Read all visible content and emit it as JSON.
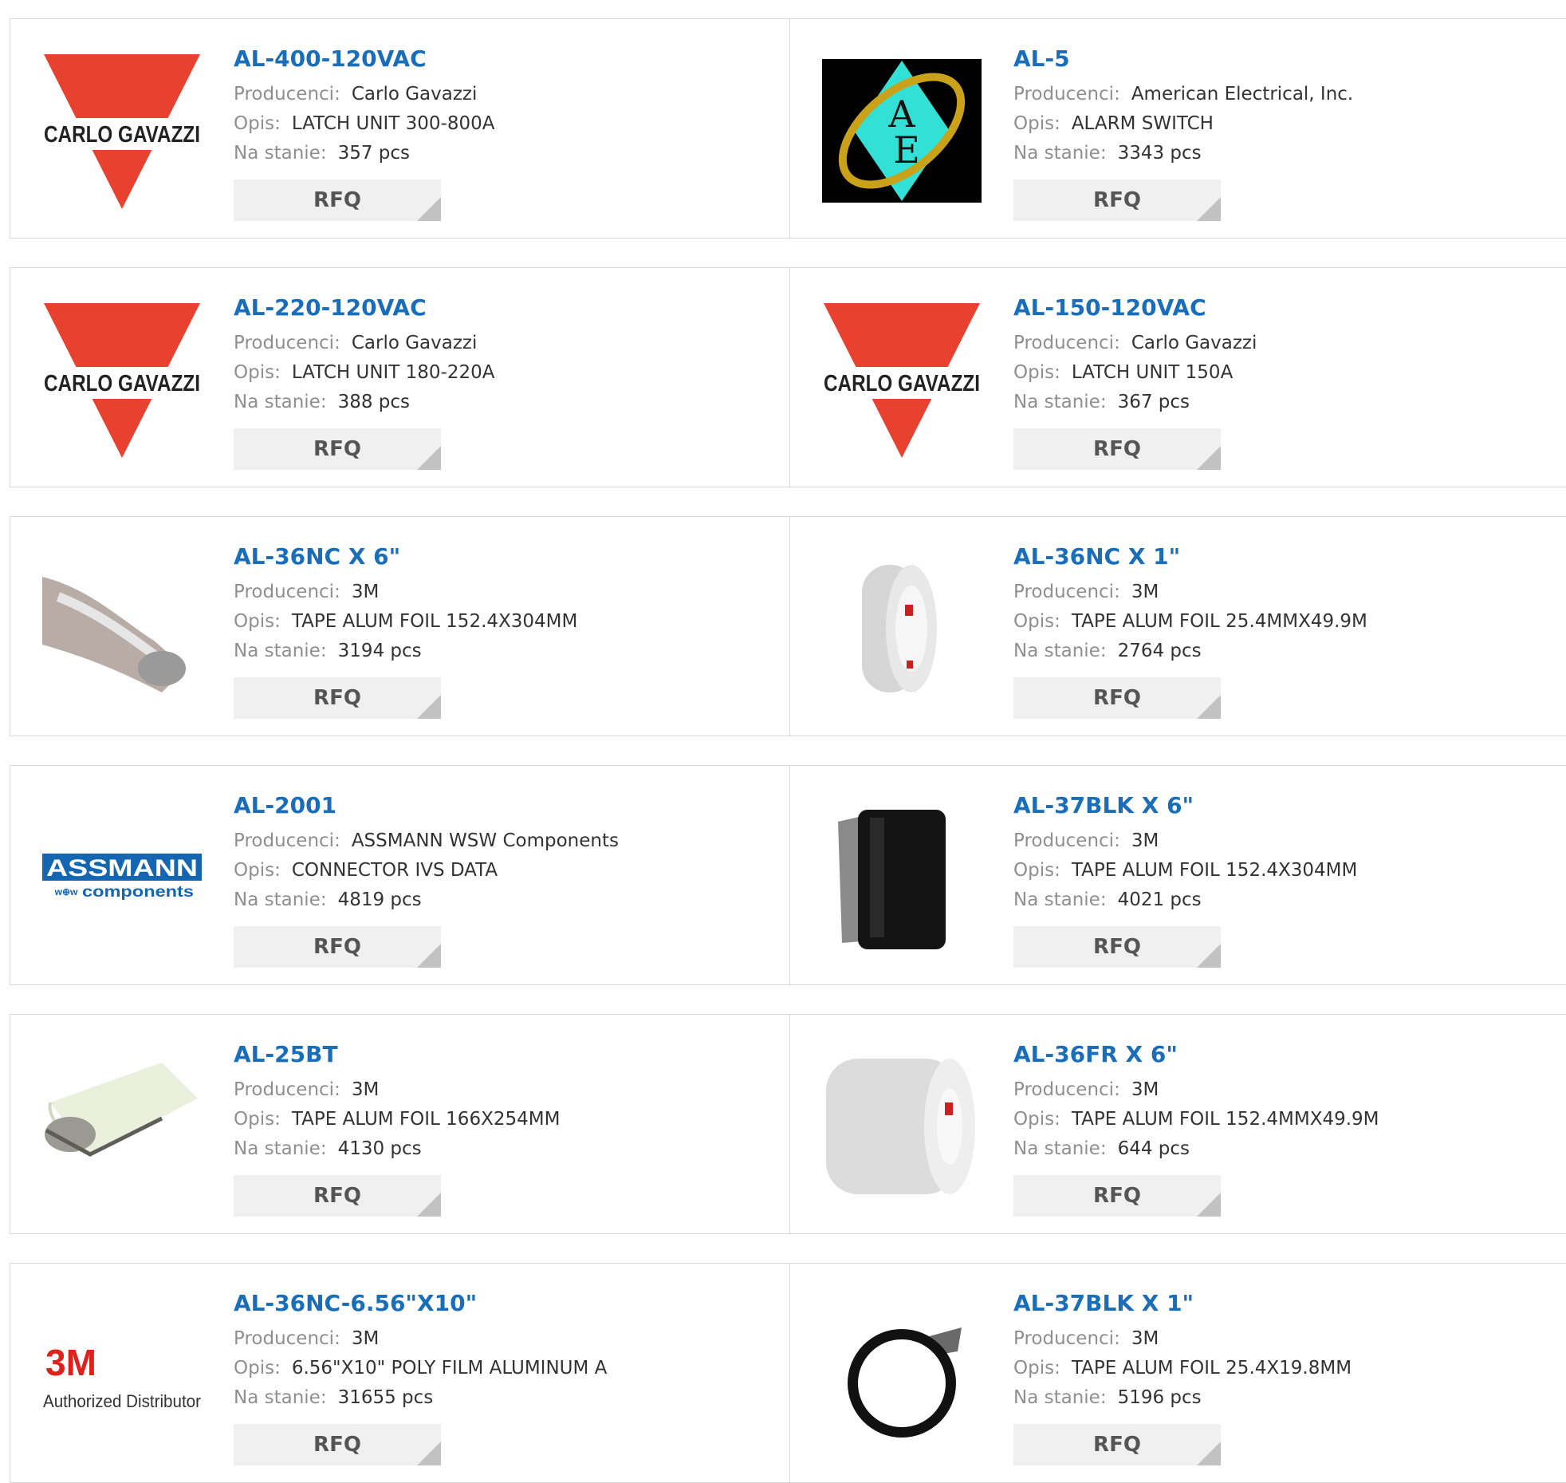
{
  "labels": {
    "manufacturer": "Producenci:",
    "description": "Opis:",
    "stock": "Na stanie:",
    "rfq": "RFQ"
  },
  "logos": {
    "carlo_gavazzi": "CARLO GAVAZZI",
    "ae": "AE",
    "assmann_top": "ASSMANN",
    "assmann_bottom": "components",
    "assmann_prefix": "w⊕w",
    "threem_mark": "3M",
    "threem_sub": "Authorized Distributor"
  },
  "colors": {
    "link": "#1a6db8",
    "rfq_bg": "#f0f0f0",
    "carlo_red": "#e8412f",
    "assmann_blue": "#1466b3",
    "threem_red": "#e0201b"
  },
  "products": [
    {
      "part": "AL-400-120VAC",
      "manufacturer": "Carlo Gavazzi",
      "description": "LATCH UNIT 300-800A",
      "stock": "357 pcs",
      "image": "carlo-gavazzi-logo"
    },
    {
      "part": "AL-5",
      "manufacturer": "American Electrical, Inc.",
      "description": "ALARM SWITCH",
      "stock": "3343 pcs",
      "image": "american-electrical-logo"
    },
    {
      "part": "AL-220-120VAC",
      "manufacturer": "Carlo Gavazzi",
      "description": "LATCH UNIT 180-220A",
      "stock": "388 pcs",
      "image": "carlo-gavazzi-logo"
    },
    {
      "part": "AL-150-120VAC",
      "manufacturer": "Carlo Gavazzi",
      "description": "LATCH UNIT 150A",
      "stock": "367 pcs",
      "image": "carlo-gavazzi-logo"
    },
    {
      "part": "AL-36NC X 6\"",
      "manufacturer": "3M",
      "description": "TAPE ALUM FOIL 152.4X304MM",
      "stock": "3194 pcs",
      "image": "foil-sheet-photo"
    },
    {
      "part": "AL-36NC X 1\"",
      "manufacturer": "3M",
      "description": "TAPE ALUM FOIL 25.4MMX49.9M",
      "stock": "2764 pcs",
      "image": "tape-roll-narrow-photo"
    },
    {
      "part": "AL-2001",
      "manufacturer": "ASSMANN WSW Components",
      "description": "CONNECTOR IVS DATA",
      "stock": "4819 pcs",
      "image": "assmann-logo"
    },
    {
      "part": "AL-37BLK X 6\"",
      "manufacturer": "3M",
      "description": "TAPE ALUM FOIL 152.4X304MM",
      "stock": "4021 pcs",
      "image": "black-film-roll-photo"
    },
    {
      "part": "AL-25BT",
      "manufacturer": "3M",
      "description": "TAPE ALUM FOIL 166X254MM",
      "stock": "4130 pcs",
      "image": "film-sheet-roll-photo"
    },
    {
      "part": "AL-36FR X 6\"",
      "manufacturer": "3M",
      "description": "TAPE ALUM FOIL 152.4MMX49.9M",
      "stock": "644 pcs",
      "image": "tape-roll-wide-photo"
    },
    {
      "part": "AL-36NC-6.56\"X10\"",
      "manufacturer": "3M",
      "description": "6.56\"X10\" POLY FILM ALUMINUM A",
      "stock": "31655 pcs",
      "image": "3m-logo"
    },
    {
      "part": "AL-37BLK X 1\"",
      "manufacturer": "3M",
      "description": "TAPE ALUM FOIL 25.4X19.8MM",
      "stock": "5196 pcs",
      "image": "black-tape-ring-photo"
    }
  ]
}
